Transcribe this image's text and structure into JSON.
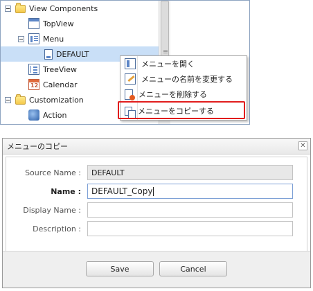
{
  "tree": {
    "items": [
      {
        "label": "View Components",
        "icon": "folder-icon"
      },
      {
        "label": "TopView",
        "icon": "window-icon"
      },
      {
        "label": "Menu",
        "icon": "menu-icon"
      },
      {
        "label": "DEFAULT",
        "icon": "page-icon",
        "selected": true
      },
      {
        "label": "TreeView",
        "icon": "tree-icon"
      },
      {
        "label": "Calendar",
        "icon": "calendar-icon"
      },
      {
        "label": "Customization",
        "icon": "folder-icon"
      },
      {
        "label": "Action",
        "icon": "action-icon"
      }
    ]
  },
  "context_menu": {
    "items": [
      {
        "label": "メニューを開く",
        "icon": "open-menu-icon"
      },
      {
        "label": "メニューの名前を変更する",
        "icon": "rename-icon"
      },
      {
        "label": "メニューを削除する",
        "icon": "delete-icon"
      },
      {
        "label": "メニューをコピーする",
        "icon": "copy-icon",
        "highlighted": true
      }
    ],
    "highlight_color": "#e11c1c"
  },
  "dialog": {
    "title": "メニューのコピー",
    "close_glyph": "✕",
    "fields": [
      {
        "label": "Source Name :",
        "value": "DEFAULT",
        "readonly": true
      },
      {
        "label": "Name :",
        "value": "DEFAULT_Copy",
        "focused": true
      },
      {
        "label": "Display Name :",
        "value": ""
      },
      {
        "label": "Description :",
        "value": ""
      }
    ],
    "save_label": "Save",
    "cancel_label": "Cancel"
  }
}
